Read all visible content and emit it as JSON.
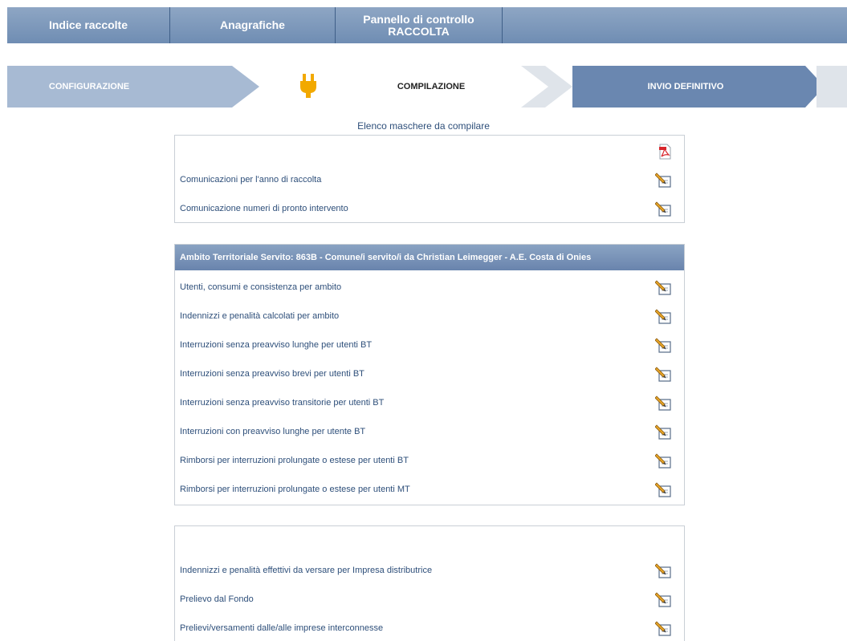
{
  "topnav": {
    "tab1": "Indice raccolte",
    "tab2": "Anagrafiche",
    "tab3_line1": "Pannello di controllo",
    "tab3_line2": "RACCOLTA"
  },
  "steps": {
    "step1": "CONFIGURAZIONE",
    "step2": "COMPILAZIONE",
    "step3": "INVIO DEFINITIVO"
  },
  "elenco_title": "Elenco maschere da compilare",
  "section1": {
    "pdf_icon": "pdf-icon",
    "items": [
      "Comunicazioni per l'anno di raccolta",
      "Comunicazione numeri di pronto intervento"
    ]
  },
  "section2": {
    "header": "Ambito Territoriale Servito: 863B - Comune/i servito/i da Christian Leimegger - A.E. Costa di Onies",
    "items": [
      "Utenti, consumi e consistenza per ambito",
      "Indennizzi e penalità calcolati per ambito",
      "Interruzioni senza preavviso lunghe per utenti BT",
      "Interruzioni senza preavviso brevi per utenti BT",
      "Interruzioni senza preavviso transitorie per utenti BT",
      "Interruzioni con preavviso lunghe per utente BT",
      "Rimborsi per interruzioni prolungate o estese per utenti BT",
      "Rimborsi per interruzioni prolungate o estese per utenti MT"
    ]
  },
  "section3": {
    "items": [
      "Indennizzi e penalità effettivi da versare per Impresa distributrice",
      "Prelievo dal Fondo",
      "Prelievi/versamenti dalle/alle imprese interconnesse"
    ]
  },
  "colors": {
    "nav": "#7893b7",
    "step_done": "#a7bad3",
    "step_final": "#6a87b0",
    "link": "#2e4f7a",
    "plug": "#f2a900"
  }
}
